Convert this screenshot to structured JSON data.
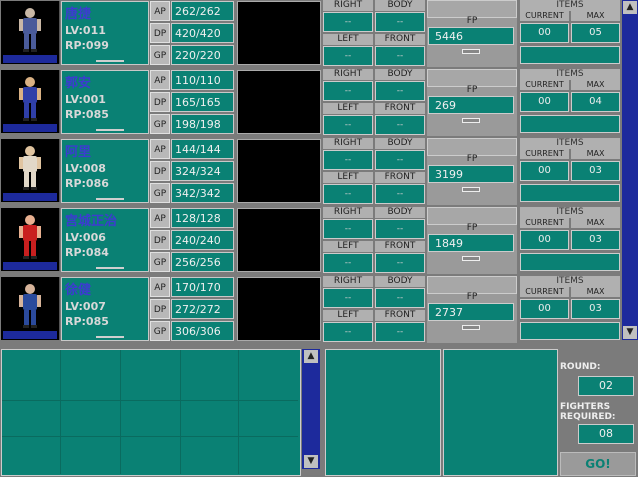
{
  "labels": {
    "ap": "AP",
    "dp": "DP",
    "gp": "GP",
    "right": "RIGHT",
    "body": "BODY",
    "left": "LEFT",
    "front": "FRONT",
    "fp": "FP",
    "items": "ITEMS",
    "current": "CURRENT",
    "max": "MAX",
    "round": "ROUND:",
    "fighters_required": "FIGHTERS REQUIRED:",
    "go": "GO!"
  },
  "fighters": [
    {
      "name": "唐捷",
      "lv": "LV:011",
      "rp": "RP:099",
      "ap": "262/262",
      "dp": "420/420",
      "gp": "220/220",
      "armor": {
        "right": "--",
        "body": "--",
        "left": "--",
        "front": "--"
      },
      "fp": "5446",
      "items_current": "00",
      "items_max": "05"
    },
    {
      "name": "郭安",
      "lv": "LV:001",
      "rp": "RP:085",
      "ap": "110/110",
      "dp": "165/165",
      "gp": "198/198",
      "armor": {
        "right": "--",
        "body": "--",
        "left": "--",
        "front": "--"
      },
      "fp": "269",
      "items_current": "00",
      "items_max": "04"
    },
    {
      "name": "阿里",
      "lv": "LV:008",
      "rp": "RP:086",
      "ap": "144/144",
      "dp": "324/324",
      "gp": "342/342",
      "armor": {
        "right": "--",
        "body": "--",
        "left": "--",
        "front": "--"
      },
      "fp": "3199",
      "items_current": "00",
      "items_max": "03"
    },
    {
      "name": "宫城正治",
      "lv": "LV:006",
      "rp": "RP:084",
      "ap": "128/128",
      "dp": "240/240",
      "gp": "256/256",
      "armor": {
        "right": "--",
        "body": "--",
        "left": "--",
        "front": "--"
      },
      "fp": "1849",
      "items_current": "00",
      "items_max": "03"
    },
    {
      "name": "徐健",
      "lv": "LV:007",
      "rp": "RP:085",
      "ap": "170/170",
      "dp": "272/272",
      "gp": "306/306",
      "armor": {
        "right": "--",
        "body": "--",
        "left": "--",
        "front": "--"
      },
      "fp": "2737",
      "items_current": "00",
      "items_max": "03"
    }
  ],
  "round": "02",
  "fighters_required_value": "08",
  "colors": {
    "teal": "#0a8174",
    "navy": "#1d2a9c",
    "gray": "#7b7b7b"
  }
}
